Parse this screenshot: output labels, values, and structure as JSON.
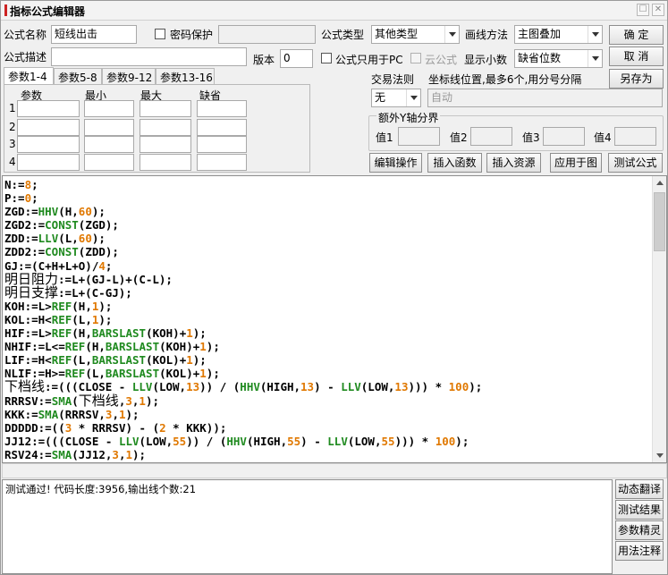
{
  "window": {
    "title": "指标公式编辑器"
  },
  "form": {
    "name_label": "公式名称",
    "name_value": "短线出击",
    "password_label": "密码保护",
    "type_label": "公式类型",
    "type_value": "其他类型",
    "draw_label": "画线方法",
    "draw_value": "主图叠加",
    "desc_label": "公式描述",
    "desc_value": "",
    "version_label": "版本",
    "version_value": "0",
    "pc_only_label": "公式只用于PC",
    "cloud_label": "云公式",
    "decimal_label": "显示小数",
    "decimal_value": "缺省位数"
  },
  "buttons": {
    "ok": "确  定",
    "cancel": "取  消",
    "save_as": "另存为",
    "edit_ops": "编辑操作",
    "insert_fn": "插入函数",
    "insert_res": "插入资源",
    "apply_chart": "应用于图",
    "test_formula": "测试公式",
    "dynamic_translate": "动态翻译",
    "test_result": "测试结果",
    "param_wizard": "参数精灵",
    "usage_notes": "用法注释"
  },
  "tabs": [
    "参数1-4",
    "参数5-8",
    "参数9-12",
    "参数13-16"
  ],
  "params": {
    "headers": [
      "参数",
      "最小",
      "最大",
      "缺省"
    ],
    "rows": [
      "1",
      "2",
      "3",
      "4"
    ]
  },
  "trade": {
    "label": "交易法则",
    "value": "无",
    "coord_label": "坐标线位置,最多6个,用分号分隔",
    "coord_value": "自动"
  },
  "yaxis": {
    "title": "额外Y轴分界",
    "values": [
      "值1",
      "值2",
      "值3",
      "值4"
    ]
  },
  "code_lines": [
    "N:=8;",
    "P:=0;",
    "ZGD:=HHV(H,60);",
    "ZGD2:=CONST(ZGD);",
    "ZDD:=LLV(L,60);",
    "ZDD2:=CONST(ZDD);",
    "GJ:=(C+H+L+O)/4;",
    "明日阻力:=L+(GJ-L)+(C-L);",
    "明日支撑:=L+(C-GJ);",
    "KOH:=L>REF(H,1);",
    "KOL:=H<REF(L,1);",
    "HIF:=L>REF(H,BARSLAST(KOH)+1);",
    "NHIF:=L<=REF(H,BARSLAST(KOH)+1);",
    "LIF:=H<REF(L,BARSLAST(KOL)+1);",
    "NLIF:=H>=REF(L,BARSLAST(KOL)+1);",
    "下档线:=(((CLOSE - LLV(LOW,13)) / (HHV(HIGH,13) - LLV(LOW,13))) * 100);",
    "RRRSV:=SMA(下档线,3,1);",
    "KKK:=SMA(RRRSV,3,1);",
    "DDDDD:=((3 * RRRSV) - (2 * KKK));",
    "JJ12:=(((CLOSE - LLV(LOW,55)) / (HHV(HIGH,55) - LLV(LOW,55))) * 100);",
    "RSV24:=SMA(JJ12,3,1);"
  ],
  "result": {
    "text": "测试通过! 代码长度:3956,输出线个数:21"
  }
}
